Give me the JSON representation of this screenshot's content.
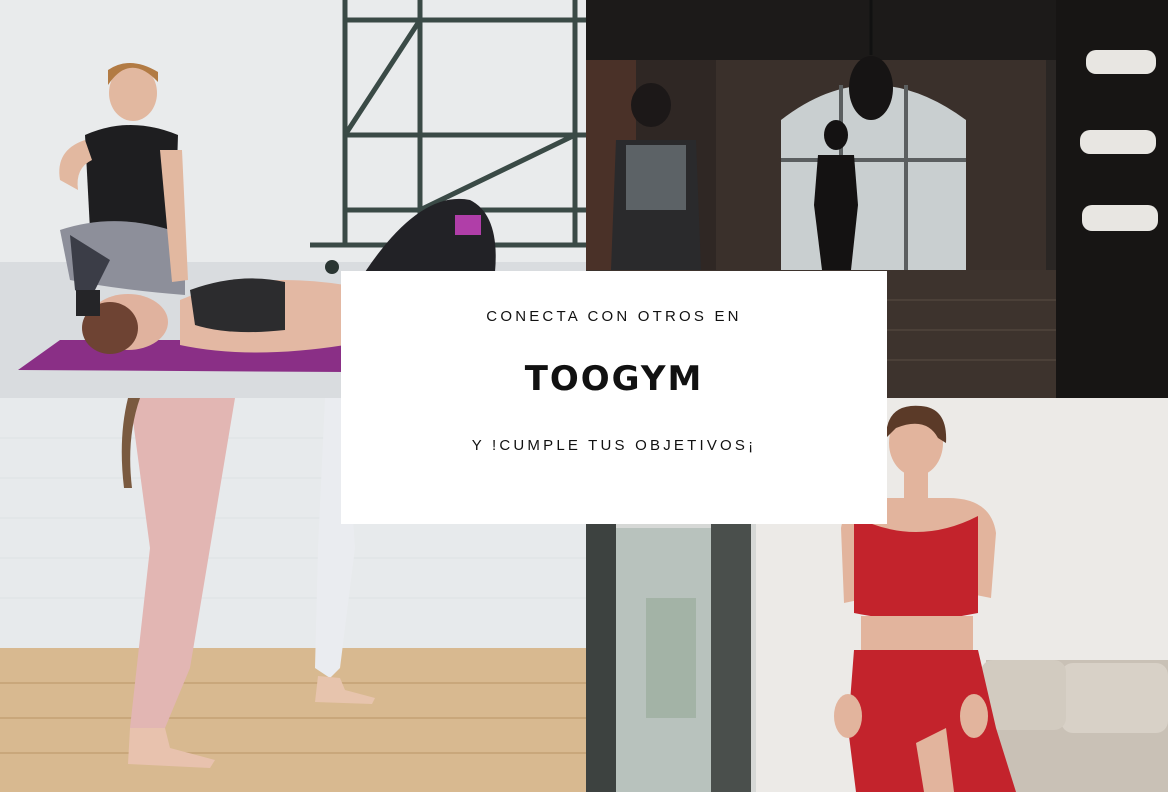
{
  "card": {
    "line1": "CONECTA CON OTROS EN",
    "title": "TOOGYM",
    "line3": "Y !CUMPLE TUS OBJETIVOS¡"
  },
  "photos": {
    "top_left": "yoga-instructor-photo",
    "top_right": "dark-gym-photo",
    "bottom_left": "legs-in-leggings-photo",
    "bottom_right": "woman-in-red-activewear-photo"
  }
}
